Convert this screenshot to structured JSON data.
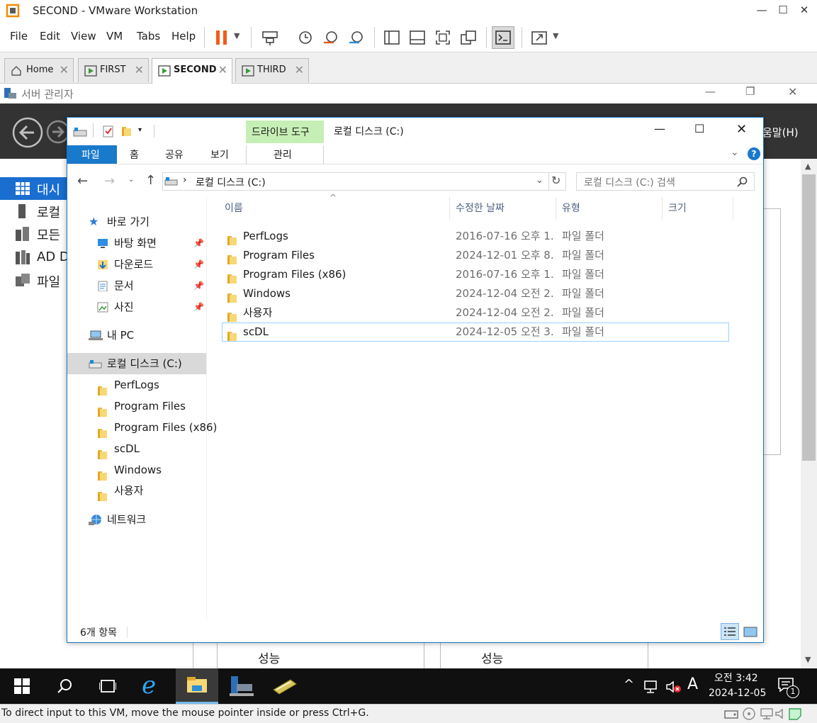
{
  "vmware": {
    "title": "SECOND - VMware Workstation",
    "menu": [
      "File",
      "Edit",
      "View",
      "VM",
      "Tabs",
      "Help"
    ],
    "tabs": [
      {
        "label": "Home",
        "active": false
      },
      {
        "label": "FIRST",
        "active": false
      },
      {
        "label": "SECOND",
        "active": true
      },
      {
        "label": "THIRD",
        "active": false
      }
    ],
    "status_text": "To direct input to this VM, move the mouse pointer inside or press Ctrl+G."
  },
  "server_manager": {
    "title": "서버 관리자",
    "help_menu": "움말(H)",
    "side_items": [
      "대시보",
      "로컬",
      "모든",
      "AD D",
      "파일"
    ],
    "bottom_labels": [
      "성능",
      "성능"
    ]
  },
  "explorer": {
    "title": "로컬 디스크 (C:)",
    "context_tab_group": "드라이브 도구",
    "context_tab": "관리",
    "ribbon_tabs": [
      "파일",
      "홈",
      "공유",
      "보기"
    ],
    "address": "로컬 디스크 (C:)",
    "search_placeholder": "로컬 디스크 (C:) 검색",
    "columns": [
      "이름",
      "수정한 날짜",
      "유형",
      "크기"
    ],
    "files": [
      {
        "name": "PerfLogs",
        "date": "2016-07-16 오후 1...",
        "type": "파일 폴더"
      },
      {
        "name": "Program Files",
        "date": "2024-12-01 오후 8...",
        "type": "파일 폴더"
      },
      {
        "name": "Program Files (x86)",
        "date": "2016-07-16 오후 1...",
        "type": "파일 폴더"
      },
      {
        "name": "Windows",
        "date": "2024-12-04 오전 2...",
        "type": "파일 폴더"
      },
      {
        "name": "사용자",
        "date": "2024-12-04 오전 2...",
        "type": "파일 폴더"
      },
      {
        "name": "scDL",
        "date": "2024-12-05 오전 3...",
        "type": "파일 폴더"
      }
    ],
    "nav": {
      "quick_access": "바로 가기",
      "quick_items": [
        "바탕 화면",
        "다운로드",
        "문서",
        "사진"
      ],
      "this_pc": "내 PC",
      "drive": "로컬 디스크 (C:)",
      "drive_children": [
        "PerfLogs",
        "Program Files",
        "Program Files (x86)",
        "scDL",
        "Windows",
        "사용자"
      ],
      "network": "네트워크"
    },
    "item_count": "6개 항목"
  },
  "taskbar": {
    "time": "오전 3:42",
    "date": "2024-12-05",
    "ime": "A",
    "notification_count": "1"
  }
}
